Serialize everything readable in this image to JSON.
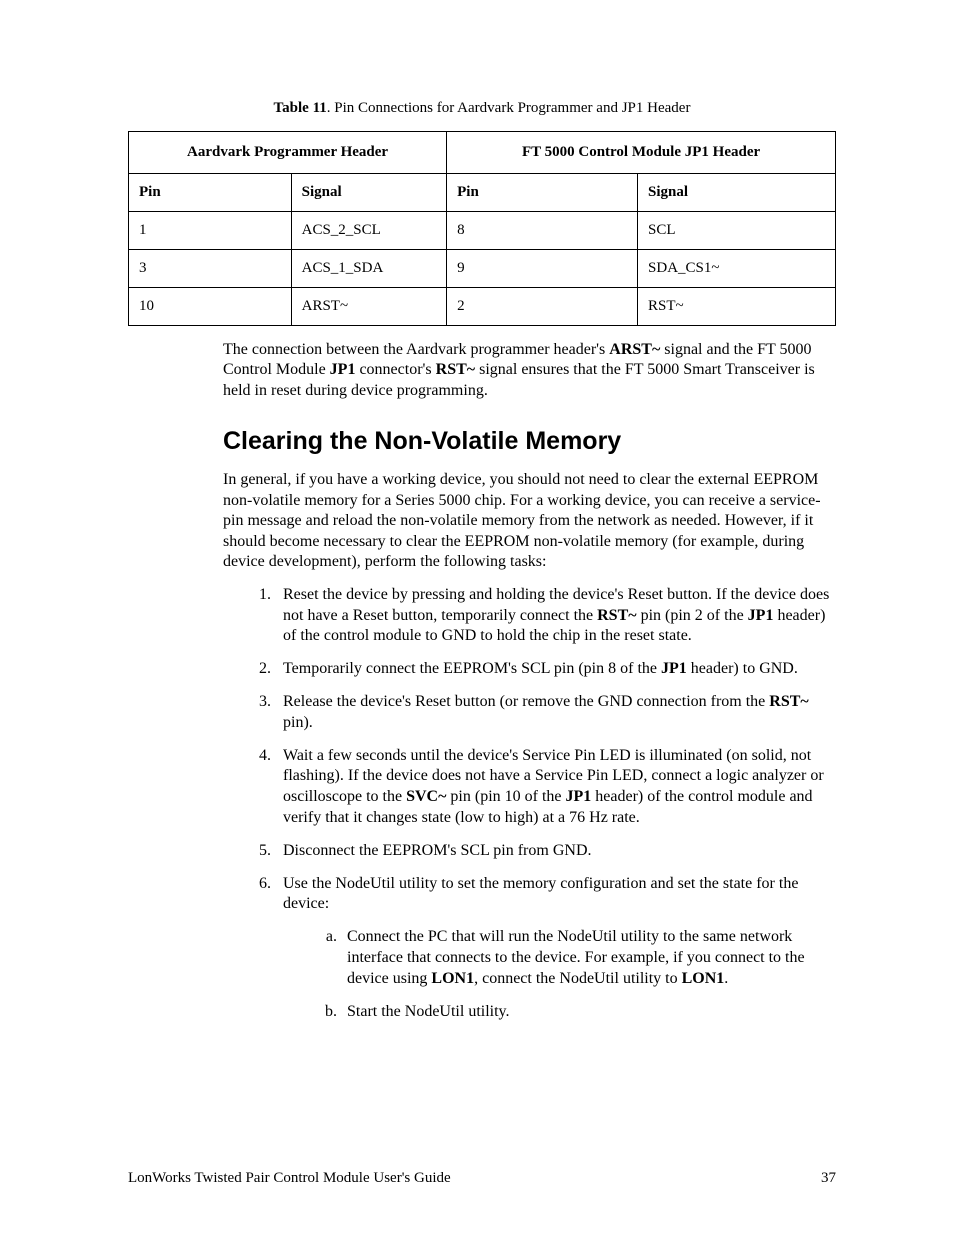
{
  "caption": {
    "label": "Table 11",
    "text": ". Pin Connections for Aardvark Programmer and JP1 Header"
  },
  "table": {
    "group1": "Aardvark Programmer Header",
    "group2": "FT 5000 Control Module JP1 Header",
    "h_pin": "Pin",
    "h_signal": "Signal",
    "rows": [
      {
        "p1": "1",
        "s1": "ACS_2_SCL",
        "p2": "8",
        "s2": "SCL"
      },
      {
        "p1": "3",
        "s1": "ACS_1_SDA",
        "p2": "9",
        "s2": "SDA_CS1~"
      },
      {
        "p1": "10",
        "s1": "ARST~",
        "p2": "2",
        "s2": "RST~"
      }
    ]
  },
  "para_conn": {
    "t1": "The connection between the Aardvark programmer header's ",
    "b1": "ARST~",
    "t2": " signal and the FT 5000 Control Module ",
    "b2": "JP1",
    "t3": " connector's ",
    "b3": "RST~",
    "t4": " signal ensures that the FT 5000 Smart Transceiver is held in reset during device programming."
  },
  "section_title": "Clearing the Non-Volatile Memory",
  "para_intro": "In general, if you have a working device, you should not need to clear the external EEPROM non-volatile memory for a Series 5000 chip.  For a working device, you can receive a service-pin message and reload the non-volatile memory from the network as needed.  However, if it should become necessary to clear the EEPROM non-volatile memory (for example, during device development), perform the following tasks:",
  "steps": {
    "s1": {
      "t1": "Reset the device by pressing and holding the device's Reset button.  If the device does not have a Reset button, temporarily connect the ",
      "b1": "RST~",
      "t2": " pin (pin 2 of the ",
      "b2": "JP1",
      "t3": " header) of the control module to GND to hold the chip in the reset state."
    },
    "s2": {
      "t1": "Temporarily connect the EEPROM's SCL pin (pin 8 of the ",
      "b1": "JP1",
      "t2": " header) to GND."
    },
    "s3": {
      "t1": "Release the device's Reset button (or remove the GND connection from the ",
      "b1": "RST~",
      "t2": " pin)."
    },
    "s4": {
      "t1": "Wait a few seconds until the device's Service Pin LED is illuminated (on solid, not flashing).  If the device does not have a Service Pin LED, connect a logic analyzer or oscilloscope to the ",
      "b1": "SVC~",
      "t2": " pin (pin 10 of the ",
      "b2": "JP1",
      "t3": " header) of the control module and verify that it changes state (low to high) at a 76 Hz rate."
    },
    "s5": "Disconnect the EEPROM's SCL pin from GND.",
    "s6": {
      "t1": "Use the NodeUtil utility to set the memory configuration and set the state for the device:",
      "a": {
        "t1": "Connect the PC that will run the NodeUtil utility to the same network interface that connects to the device.  For example, if you connect to the device using ",
        "b1": "LON1",
        "t2": ", connect the NodeUtil utility to ",
        "b2": "LON1",
        "t3": "."
      },
      "b": "Start the NodeUtil utility."
    }
  },
  "footer": {
    "left": "LonWorks Twisted Pair Control Module User's Guide",
    "right": "37"
  }
}
